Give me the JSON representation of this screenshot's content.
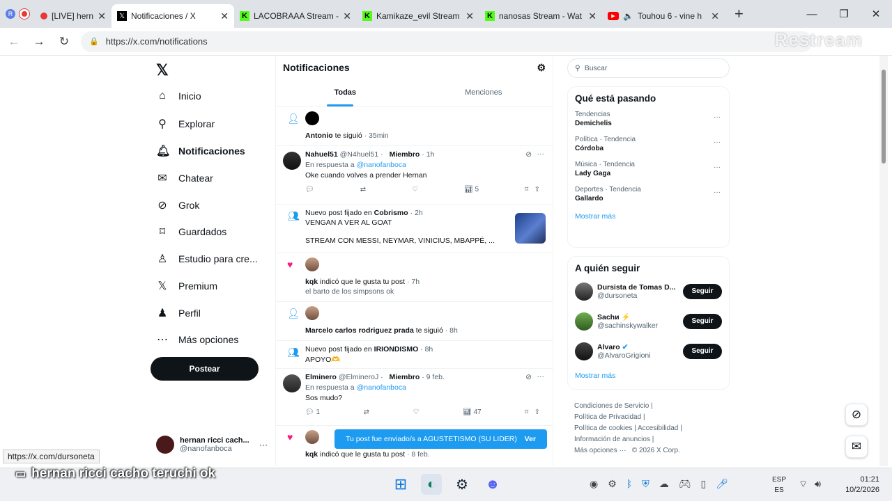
{
  "browser": {
    "tabs": [
      {
        "label": "[LIVE] hernan",
        "favicon": "live-dot"
      },
      {
        "label": "Notificaciones / X",
        "favicon": "x-logo",
        "active": true
      },
      {
        "label": "LACOBRAAA Stream -",
        "favicon": "kick-k"
      },
      {
        "label": "Kamikaze_evil Stream",
        "favicon": "kick-k"
      },
      {
        "label": "nanosas Stream - Wat",
        "favicon": "kick-k"
      },
      {
        "label": "Touhou 6 - vine h",
        "favicon": "youtube"
      }
    ],
    "url": "https://x.com/notifications",
    "watermark": "Restream"
  },
  "leftnav": {
    "items": [
      {
        "label": "Inicio",
        "icon": "home-icon"
      },
      {
        "label": "Explorar",
        "icon": "search-icon"
      },
      {
        "label": "Notificaciones",
        "icon": "bell-icon"
      },
      {
        "label": "Chatear",
        "icon": "mail-icon"
      },
      {
        "label": "Grok",
        "icon": "grok-icon"
      },
      {
        "label": "Guardados",
        "icon": "bookmark-icon"
      },
      {
        "label": "Estudio para cre...",
        "icon": "studio-icon"
      },
      {
        "label": "Premium",
        "icon": "x-icon"
      },
      {
        "label": "Perfil",
        "icon": "person-icon"
      },
      {
        "label": "Más opciones",
        "icon": "more-icon"
      }
    ],
    "post_label": "Postear",
    "account": {
      "name": "hernan ricci cach...",
      "handle": "@nanofanboca"
    }
  },
  "center": {
    "title": "Notificaciones",
    "tabs": [
      "Todas",
      "Menciones"
    ],
    "n1": {
      "who": "Antonio",
      "text": "te siguió",
      "time": "· 35min"
    },
    "n2": {
      "name": "Nahuel51",
      "handle": "@N4huel51 ·",
      "badge": "Miembro",
      "time": "· 1h",
      "reply_prefix": "En respuesta a",
      "reply_to": "@nanofanboca",
      "body": "Oke cuando volves a prender Hernan",
      "views": "5"
    },
    "n3": {
      "prefix": "Nuevo post fijado en",
      "community": "Cobrismo",
      "time": "· 2h",
      "line1": "VENGAN A VER AL GOAT",
      "line2": "STREAM CON MESSI, NEYMAR, VINICIUS, MBAPPÉ, ..."
    },
    "n4": {
      "who": "kqk",
      "text": "indicó que le gusta tu post",
      "time": "· 7h",
      "quote": "el barto de los simpsons ok"
    },
    "n5": {
      "who": "Marcelo carlos rodriguez prada",
      "text": "te siguió",
      "time": "· 8h"
    },
    "n6": {
      "prefix": "Nuevo post fijado en",
      "community": "IRIONDISMO",
      "time": "· 8h",
      "line1": "APOYO🫶"
    },
    "n7": {
      "name": "Elminero",
      "handle": "@ElmineroJ ·",
      "badge": "Miembro",
      "time": "· 9 feb.",
      "reply_prefix": "En respuesta a",
      "reply_to": "@nanofanboca",
      "body": "Sos mudo?",
      "replies": "1",
      "views": "47"
    },
    "n8": {
      "who": "kqk",
      "text": "indicó que le gusta tu post",
      "time": "· 8 feb."
    },
    "toast": {
      "text": "Tu post fue enviado/s a AGUSTETISMO (SU LIDER)",
      "action": "Ver"
    }
  },
  "right": {
    "search_placeholder": "Buscar",
    "trends_title": "Qué está pasando",
    "trends": [
      {
        "category": "Tendencias",
        "name": "Demichelis"
      },
      {
        "category": "Política · Tendencia",
        "name": "Córdoba"
      },
      {
        "category": "Música · Tendencia",
        "name": "Lady Gaga"
      },
      {
        "category": "Deportes · Tendencia",
        "name": "Gallardo"
      }
    ],
    "show_more": "Mostrar más",
    "who_title": "A quién seguir",
    "who": [
      {
        "name": "Dursista de Tomas D...",
        "handle": "@dursoneta",
        "button": "Seguir"
      },
      {
        "name": "Sachи ⚡",
        "handle": "@sachinskywalker",
        "button": "Seguir"
      },
      {
        "name": "Alvaro",
        "handle": "@AlvaroGrigioni",
        "button": "Seguir"
      }
    ],
    "footer": {
      "terms": "Condiciones de Servicio",
      "privacy": "Política de Privacidad",
      "cookies": "Política de cookies",
      "access": "Accesibilidad",
      "ads": "Información de anuncios",
      "more": "Más opciones ···",
      "copyright": "© 2026 X Corp."
    }
  },
  "status_url": "https://x.com/dursoneta",
  "overlay_text": "hernan ricci cacho teruchi ok",
  "taskbar": {
    "lang1": "ESP",
    "lang2": "ES",
    "time": "01:21",
    "date": "10/2/2026"
  }
}
